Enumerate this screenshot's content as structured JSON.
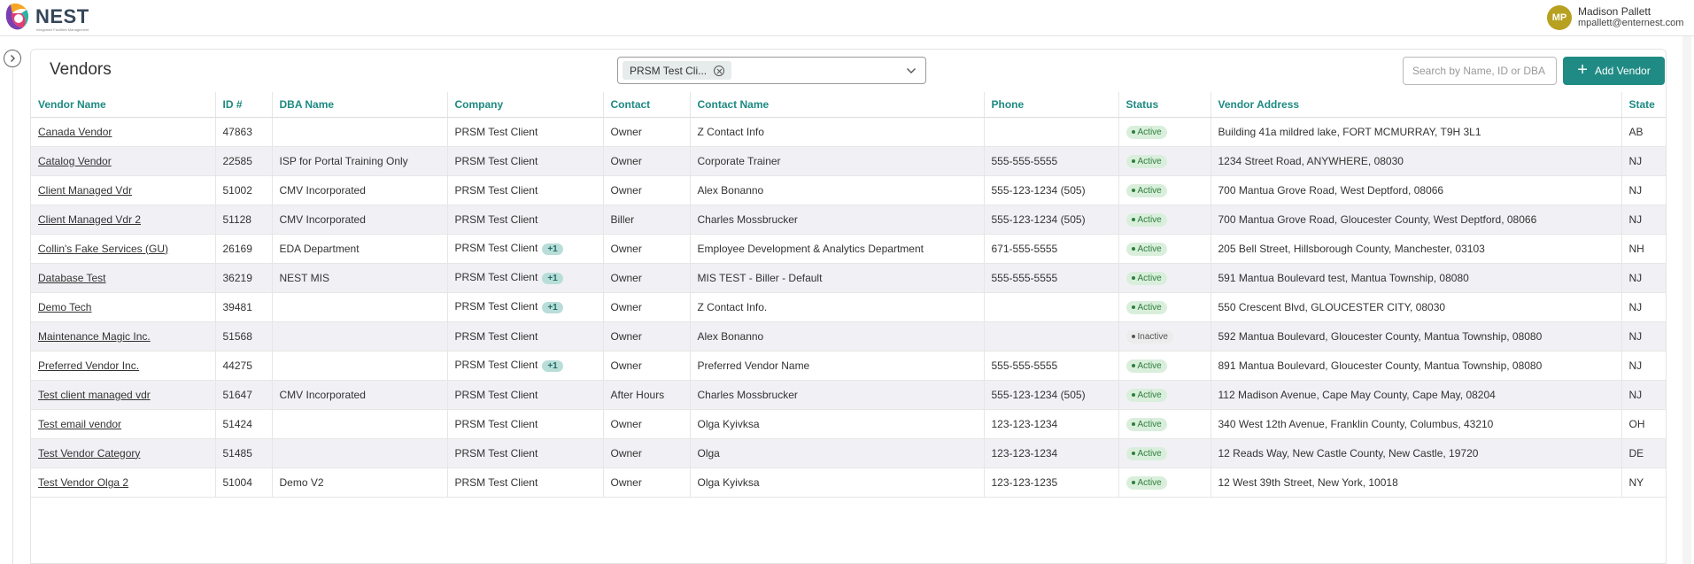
{
  "app": {
    "logo_text": "NEST",
    "logo_sub": "Integrated Facilities Management"
  },
  "user": {
    "initials": "MP",
    "name": "Madison Pallett",
    "email": "mpallett@enternest.com"
  },
  "page": {
    "title": "Vendors",
    "client_filter_chip": "PRSM Test Cli...",
    "search_placeholder": "Search by Name, ID or DBA",
    "add_button_label": "Add Vendor"
  },
  "colors": {
    "accent": "#1f8b84",
    "header_text": "#1d8a82",
    "active_badge_bg": "#d9efdc",
    "plus_badge_bg": "#b9ddd8"
  },
  "table": {
    "columns": [
      "Vendor Name",
      "ID #",
      "DBA Name",
      "Company",
      "Contact",
      "Contact Name",
      "Phone",
      "Status",
      "Vendor Address",
      "State"
    ],
    "rows": [
      {
        "name": "Canada Vendor",
        "id": "47863",
        "dba": "",
        "company": "PRSM Test Client",
        "extra": "",
        "contact": "Owner",
        "contact_name": "Z Contact Info",
        "phone": "",
        "status": "Active",
        "address": "Building 41a mildred lake, FORT MCMURRAY, T9H 3L1",
        "state": "AB"
      },
      {
        "name": "Catalog Vendor",
        "id": "22585",
        "dba": "ISP for Portal Training Only",
        "company": "PRSM Test Client",
        "extra": "",
        "contact": "Owner",
        "contact_name": "Corporate Trainer",
        "phone": "555-555-5555",
        "status": "Active",
        "address": "1234 Street Road, ANYWHERE, 08030",
        "state": "NJ"
      },
      {
        "name": "Client Managed Vdr",
        "id": "51002",
        "dba": "CMV Incorporated",
        "company": "PRSM Test Client",
        "extra": "",
        "contact": "Owner",
        "contact_name": "Alex Bonanno",
        "phone": "555-123-1234 (505)",
        "status": "Active",
        "address": "700 Mantua Grove Road, West Deptford, 08066",
        "state": "NJ"
      },
      {
        "name": "Client Managed Vdr 2",
        "id": "51128",
        "dba": "CMV Incorporated",
        "company": "PRSM Test Client",
        "extra": "",
        "contact": "Biller",
        "contact_name": "Charles Mossbrucker",
        "phone": "555-123-1234 (505)",
        "status": "Active",
        "address": "700 Mantua Grove Road, Gloucester County, West Deptford, 08066",
        "state": "NJ"
      },
      {
        "name": "Collin's Fake Services (GU)",
        "id": "26169",
        "dba": "EDA Department",
        "company": "PRSM Test Client",
        "extra": "+1",
        "contact": "Owner",
        "contact_name": "Employee Development & Analytics Department",
        "phone": "671-555-5555",
        "status": "Active",
        "address": "205 Bell Street, Hillsborough County, Manchester, 03103",
        "state": "NH"
      },
      {
        "name": "Database Test",
        "id": "36219",
        "dba": "NEST MIS",
        "company": "PRSM Test Client",
        "extra": "+1",
        "contact": "Owner",
        "contact_name": "MIS TEST - Biller - Default",
        "phone": "555-555-5555",
        "status": "Active",
        "address": "591 Mantua Boulevard test, Mantua Township, 08080",
        "state": "NJ"
      },
      {
        "name": "Demo Tech",
        "id": "39481",
        "dba": "",
        "company": "PRSM Test Client",
        "extra": "+1",
        "contact": "Owner",
        "contact_name": "Z Contact Info.",
        "phone": "",
        "status": "Active",
        "address": "550 Crescent Blvd, GLOUCESTER CITY, 08030",
        "state": "NJ"
      },
      {
        "name": "Maintenance Magic Inc.",
        "id": "51568",
        "dba": "",
        "company": "PRSM Test Client",
        "extra": "",
        "contact": "Owner",
        "contact_name": "Alex Bonanno",
        "phone": "",
        "status": "Inactive",
        "address": "592 Mantua Boulevard, Gloucester County, Mantua Township, 08080",
        "state": "NJ"
      },
      {
        "name": "Preferred Vendor Inc.",
        "id": "44275",
        "dba": "",
        "company": "PRSM Test Client",
        "extra": "+1",
        "contact": "Owner",
        "contact_name": "Preferred Vendor Name",
        "phone": "555-555-5555",
        "status": "Active",
        "address": "891 Mantua Boulevard, Gloucester County, Mantua Township, 08080",
        "state": "NJ"
      },
      {
        "name": "Test client managed vdr",
        "id": "51647",
        "dba": "CMV Incorporated",
        "company": "PRSM Test Client",
        "extra": "",
        "contact": "After Hours",
        "contact_name": "Charles Mossbrucker",
        "phone": "555-123-1234 (505)",
        "status": "Active",
        "address": "112 Madison Avenue, Cape May County, Cape May, 08204",
        "state": "NJ"
      },
      {
        "name": "Test email vendor",
        "id": "51424",
        "dba": "",
        "company": "PRSM Test Client",
        "extra": "",
        "contact": "Owner",
        "contact_name": "Olga Kyivksa",
        "phone": "123-123-1234",
        "status": "Active",
        "address": "340 West 12th Avenue, Franklin County, Columbus, 43210",
        "state": "OH"
      },
      {
        "name": "Test Vendor Category",
        "id": "51485",
        "dba": "",
        "company": "PRSM Test Client",
        "extra": "",
        "contact": "Owner",
        "contact_name": "Olga",
        "phone": "123-123-1234",
        "status": "Active",
        "address": "12 Reads Way, New Castle County, New Castle, 19720",
        "state": "DE"
      },
      {
        "name": "Test Vendor Olga 2",
        "id": "51004",
        "dba": "Demo V2",
        "company": "PRSM Test Client",
        "extra": "",
        "contact": "Owner",
        "contact_name": "Olga Kyivksa",
        "phone": "123-123-1235",
        "status": "Active",
        "address": "12 West 39th Street, New York, 10018",
        "state": "NY"
      }
    ]
  }
}
